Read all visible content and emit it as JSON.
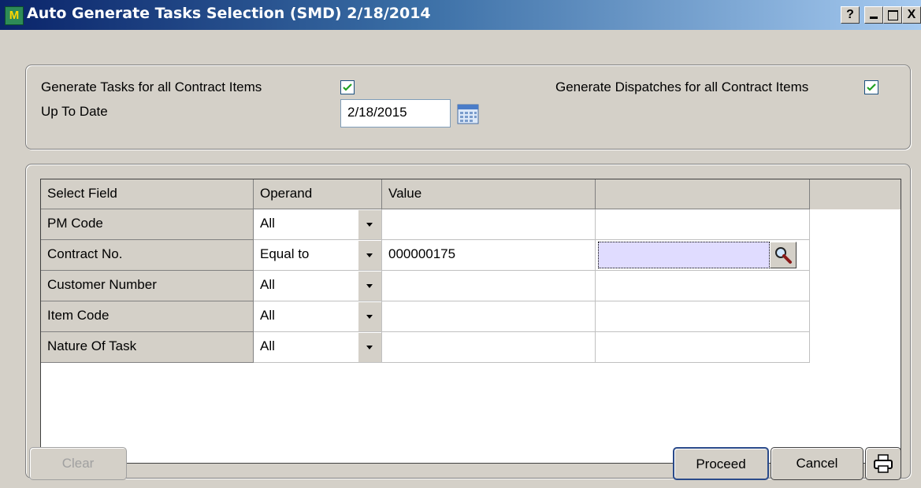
{
  "window": {
    "title": "Auto Generate Tasks Selection (SMD) 2/18/2014",
    "icon": "app-icon",
    "controls": [
      "?",
      "_",
      "□",
      "X"
    ]
  },
  "options": {
    "generate_tasks_label": "Generate Tasks for all Contract Items",
    "generate_tasks_checked": true,
    "generate_dispatches_label": "Generate Dispatches for all Contract Items",
    "generate_dispatches_checked": true,
    "up_to_date_label": "Up To Date",
    "up_to_date_value": "2/18/2015"
  },
  "grid": {
    "headers": [
      "Select Field",
      "Operand",
      "Value",
      ""
    ],
    "rows": [
      {
        "field": "PM Code",
        "operand": "All",
        "value": "",
        "extra": ""
      },
      {
        "field": "Contract No.",
        "operand": "Equal to",
        "value": "000000175",
        "extra": ""
      },
      {
        "field": "Customer Number",
        "operand": "All",
        "value": "",
        "extra": ""
      },
      {
        "field": "Item Code",
        "operand": "All",
        "value": "",
        "extra": ""
      },
      {
        "field": "Nature Of Task",
        "operand": "All",
        "value": "",
        "extra": ""
      }
    ]
  },
  "buttons": {
    "clear": "Clear",
    "proceed": "Proceed",
    "cancel": "Cancel"
  },
  "colors": {
    "title_gradient_start": "#0a246a",
    "title_gradient_end": "#a6caf0",
    "face": "#d4d0c8",
    "focus_cell": "#e0dcff",
    "check": "#21a121"
  }
}
